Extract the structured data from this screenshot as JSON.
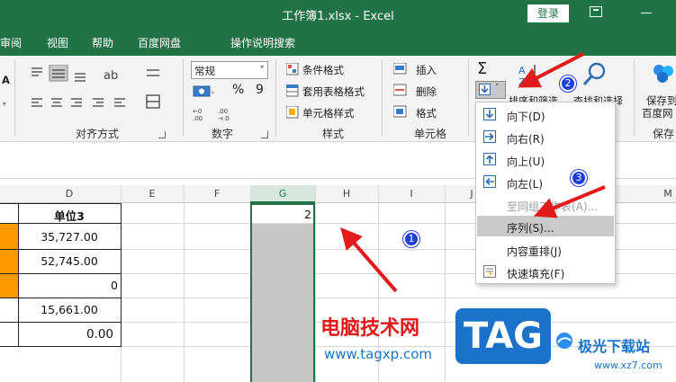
{
  "titlebar": {
    "title": "工作簿1.xlsx  -  Excel",
    "login": "登录"
  },
  "menubar": {
    "items": [
      "审阅",
      "视图",
      "帮助",
      "百度网盘",
      "操作说明搜索"
    ]
  },
  "ribbon": {
    "alignment_label": "对齐方式",
    "number_format": "常规",
    "number_label": "数字",
    "percent": "%",
    "comma": "9",
    "conditional_format": "条件格式",
    "table_format": "套用表格格式",
    "cell_style": "单元格样式",
    "styles_label": "样式",
    "insert": "插入",
    "delete": "删除",
    "format": "格式",
    "cells_label": "单元格",
    "sort_filter": "排序和筛选",
    "find_select": "查找和选择",
    "save_to": "保存到",
    "baidu": "百度网",
    "save_label": "保存",
    "sigma": "Σ"
  },
  "columns": [
    "D",
    "E",
    "F",
    "G",
    "H",
    "I",
    "J",
    "M"
  ],
  "sheet": {
    "d_header": "单位3",
    "d_values": [
      "35,727.00",
      "52,745.00",
      "0",
      "15,661.00",
      "0.00"
    ],
    "g_value": "2"
  },
  "fill_menu": {
    "items": [
      {
        "label": "向下(D)",
        "icon": "arrow-down-icon"
      },
      {
        "label": "向右(R)",
        "icon": "arrow-right-icon"
      },
      {
        "label": "向上(U)",
        "icon": "arrow-up-icon"
      },
      {
        "label": "向左(L)",
        "icon": "arrow-left-icon"
      },
      {
        "label": "至同组工作表(A)...",
        "icon": ""
      },
      {
        "label": "序列(S)...",
        "icon": ""
      },
      {
        "label": "内容重排(J)",
        "icon": ""
      },
      {
        "label": "快速填充(F)",
        "icon": "flash-fill-icon"
      }
    ]
  },
  "markers": [
    "1",
    "2",
    "3"
  ],
  "watermark": {
    "cn": "电脑技术网",
    "url": "www.tagxp.com",
    "tag": "TAG",
    "site": "极光下载站",
    "site_url": "www.xz7.com"
  },
  "colors": {
    "excel_green": "#217346",
    "orange": "#ff9a00",
    "watermark_red": "#e21a1a",
    "tag_blue": "#1a73c8"
  }
}
